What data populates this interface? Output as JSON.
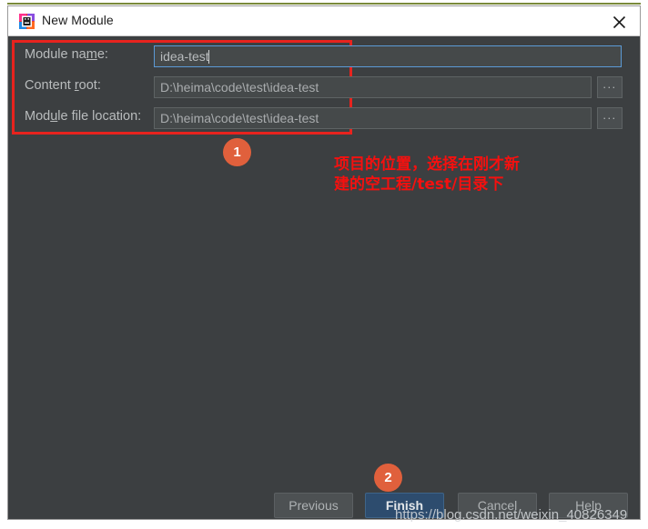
{
  "window": {
    "title": "New Module",
    "icon": "intellij-idea-icon",
    "close_icon": "close-icon"
  },
  "form": {
    "rows": [
      {
        "label_pre": "Module na",
        "label_mnemonic": "m",
        "label_post": "e:",
        "value": "idea-test",
        "focused": true,
        "has_browse": false
      },
      {
        "label_pre": "Content ",
        "label_mnemonic": "r",
        "label_post": "oot:",
        "value": "D:\\heima\\code\\test\\idea-test",
        "focused": false,
        "has_browse": true
      },
      {
        "label_pre": "Mod",
        "label_mnemonic": "u",
        "label_post": "le file location:",
        "value": "D:\\heima\\code\\test\\idea-test",
        "focused": false,
        "has_browse": true
      }
    ],
    "browse_label": "..."
  },
  "annotations": {
    "badge_1": "1",
    "badge_2": "2",
    "note_line1": "项目的位置，选择在刚才新",
    "note_line2": "建的空工程/test/目录下",
    "highlight_color": "#e8231e",
    "badge_color": "#e0603c",
    "note_color": "#f5100f"
  },
  "footer": {
    "previous": "Previous",
    "finish": "Finish",
    "cancel": "Cancel",
    "help": "Help"
  },
  "watermark": {
    "url": "https://blog.csdn.net/weixin_40826349"
  }
}
